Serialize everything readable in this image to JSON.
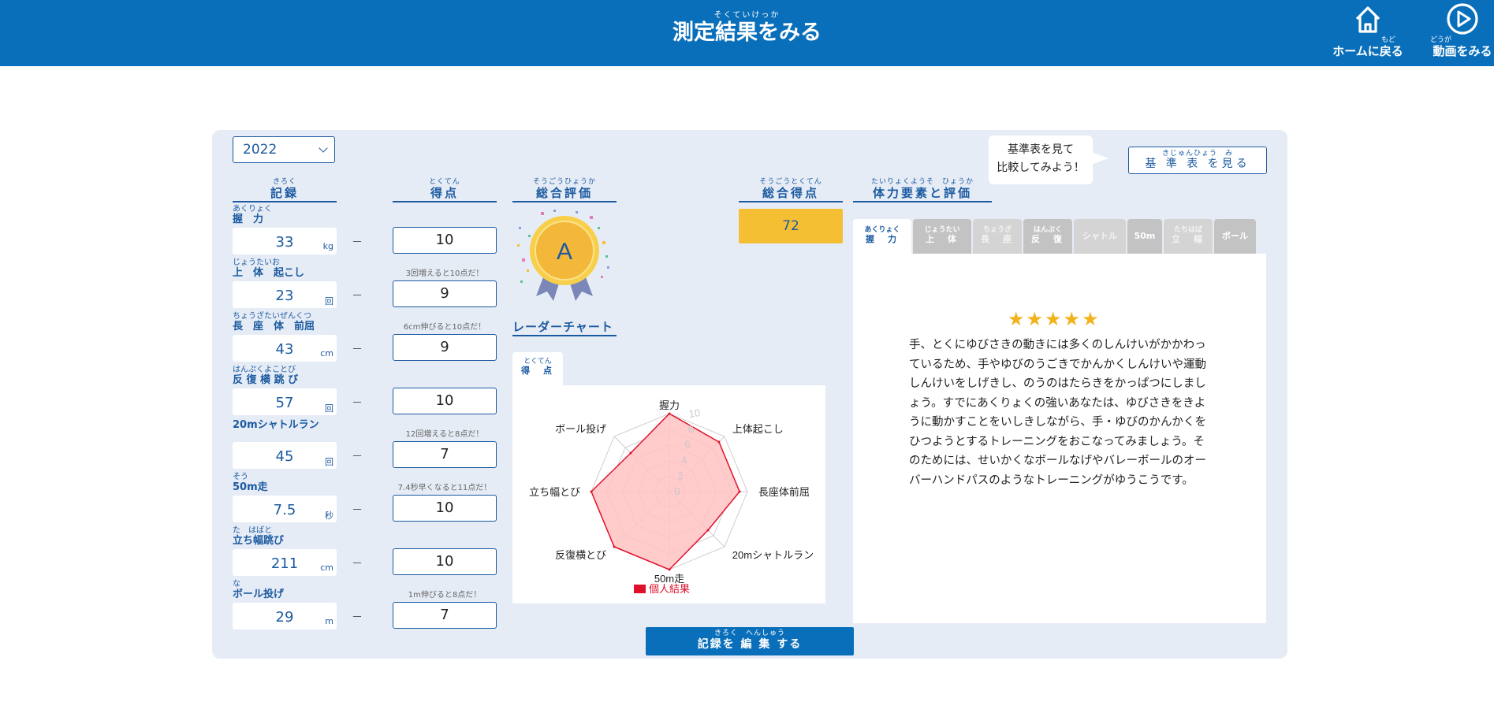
{
  "header": {
    "title_ruby": "そくていけっか",
    "title": "測定結果をみる",
    "home_ruby": "もど",
    "home_label": "ホームに戻る",
    "video_ruby": "どうが",
    "video_label": "動画をみる"
  },
  "year": "2022",
  "columns": {
    "record_ruby": "きろく",
    "record": "記録",
    "score_ruby": "とくてん",
    "score": "得点",
    "overall_ruby": "そうごうひょうか",
    "overall": "総合評価",
    "total_ruby": "そうごうとくてん",
    "total": "総合得点",
    "element_ruby": "たいりょくようそ　ひょうか",
    "element": "体力要素と評価"
  },
  "records": [
    {
      "ruby": "あくりょく",
      "label": "握　力",
      "value": "33",
      "unit": "kg",
      "score": "10",
      "hint": ""
    },
    {
      "ruby": "じょうたいお",
      "label": "上　体　起こし",
      "value": "23",
      "unit": "回",
      "score": "9",
      "hint": "3回増えると10点だ！"
    },
    {
      "ruby": "ちょうざたいぜんくつ",
      "label": "長　座　体　前屈",
      "value": "43",
      "unit": "cm",
      "score": "9",
      "hint": "6cm伸びると10点だ！"
    },
    {
      "ruby": "はんぷくよことび",
      "label": "反 復 横 跳 び",
      "value": "57",
      "unit": "回",
      "score": "10",
      "hint": ""
    },
    {
      "ruby": "",
      "label": "20mシャトルラン",
      "value": "45",
      "unit": "回",
      "score": "7",
      "hint": "12回増えると8点だ！"
    },
    {
      "ruby": "そう",
      "label": "50m走",
      "value": "7.5",
      "unit": "秒",
      "score": "10",
      "hint": "7.4秒早くなると11点だ！"
    },
    {
      "ruby": "た　はばと",
      "label": "立ち幅跳び",
      "value": "211",
      "unit": "cm",
      "score": "10",
      "hint": ""
    },
    {
      "ruby": "な",
      "label": "ボール投げ",
      "value": "29",
      "unit": "m",
      "score": "7",
      "hint": "1m伸びると8点だ！"
    }
  ],
  "dash": "－",
  "overall_grade": "A",
  "total_score": "72",
  "radar": {
    "title": "レーダーチャート",
    "tab_ruby": "とくてん",
    "tab_label": "得　点",
    "legend": "個人結果",
    "axis_ticks": [
      "0",
      "2",
      "4",
      "6",
      "8",
      "10"
    ]
  },
  "chart_data": {
    "type": "radar",
    "categories": [
      "握力",
      "上体起こし",
      "長座体前屈",
      "反復横とび",
      "20mシャトルラン",
      "50m走",
      "反復横とび",
      "立ち幅とび",
      "ボール投げ"
    ],
    "axes": [
      "握力",
      "上体起こし",
      "長座体前屈",
      "20mシャトルラン",
      "50m走",
      "反復横とび",
      "立ち幅とび",
      "ボール投げ"
    ],
    "series": [
      {
        "name": "個人結果",
        "values": [
          10,
          9,
          9,
          7,
          10,
          10,
          10,
          7
        ]
      }
    ],
    "rlim": [
      0,
      10
    ],
    "colors": {
      "fill": "#ffc2c2",
      "stroke": "#e0102a",
      "legend": "#e0102a"
    }
  },
  "callout": {
    "line1": "基準表を見て",
    "line2": "比較してみよう！"
  },
  "kijun": {
    "ruby": "きじゅんひょう　み",
    "label": "基 準 表 を見る"
  },
  "tabs": [
    {
      "ruby": "あくりょく",
      "label": "握　力",
      "state": "active"
    },
    {
      "ruby": "じょうたい",
      "label": "上　体",
      "state": "normal"
    },
    {
      "ruby": "ちょうざ",
      "label": "長　座",
      "state": "faded"
    },
    {
      "ruby": "はんぷく",
      "label": "反　復",
      "state": "normal"
    },
    {
      "ruby": "",
      "label": "シャトル",
      "state": "faded"
    },
    {
      "ruby": "",
      "label": "50m",
      "state": "normal"
    },
    {
      "ruby": "たちはば",
      "label": "立　幅",
      "state": "faded"
    },
    {
      "ruby": "",
      "label": "ボール",
      "state": "normal"
    }
  ],
  "evaluation": {
    "stars": "★★★★★",
    "text": "手、とくにゆびさきの動きには多くのしんけいがかかわっているため、手やゆびのうごきでかんかくしんけいや運動しんけいをしげきし、のうのはたらきをかっぱつにしましょう。すでにあくりょくの強いあなたは、ゆびさきをきように動かすことをいしきしながら、手・ゆびのかんかくをひつようとするトレーニングをおこなってみましょう。そのためには、せいかくなボールなげやバレーボールのオーバーハンドパスのようなトレーニングがゆうこうです。"
  },
  "edit": {
    "ruby": "きろく　へんしゅう",
    "label": "記録を 編 集 する"
  },
  "colors": {
    "header": "#0a6fba",
    "panel": "#e6ecf6",
    "accent": "#1b5aa0",
    "total": "#f5bf34",
    "star": "#f2b21c"
  }
}
